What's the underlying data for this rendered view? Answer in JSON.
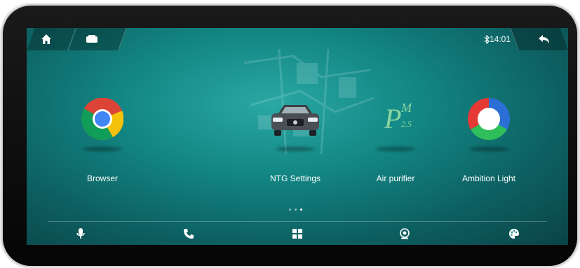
{
  "status_bar": {
    "time": "14:01",
    "bluetooth_icon": "bluetooth-icon"
  },
  "top_bar": {
    "home_icon": "home-icon",
    "apps_icon": "apps-card-icon",
    "back_icon": "back-arrow-icon"
  },
  "apps": [
    {
      "label": "Browser",
      "icon": "chrome-icon"
    },
    {
      "label": "NTG Settings",
      "icon": "car-icon"
    },
    {
      "label": "Air purifier",
      "icon": "pm25-icon"
    },
    {
      "label": "Ambition Light",
      "icon": "color-ring-icon"
    }
  ],
  "pm_icon_text": {
    "big": "P",
    "sup": "M",
    "sub": "2.5"
  },
  "dock": [
    "microphone-icon",
    "phone-icon",
    "grid-icon",
    "camera-icon",
    "palette-icon"
  ],
  "colors": {
    "screen_bg": "#138784",
    "accent": "#2aa8a4"
  }
}
